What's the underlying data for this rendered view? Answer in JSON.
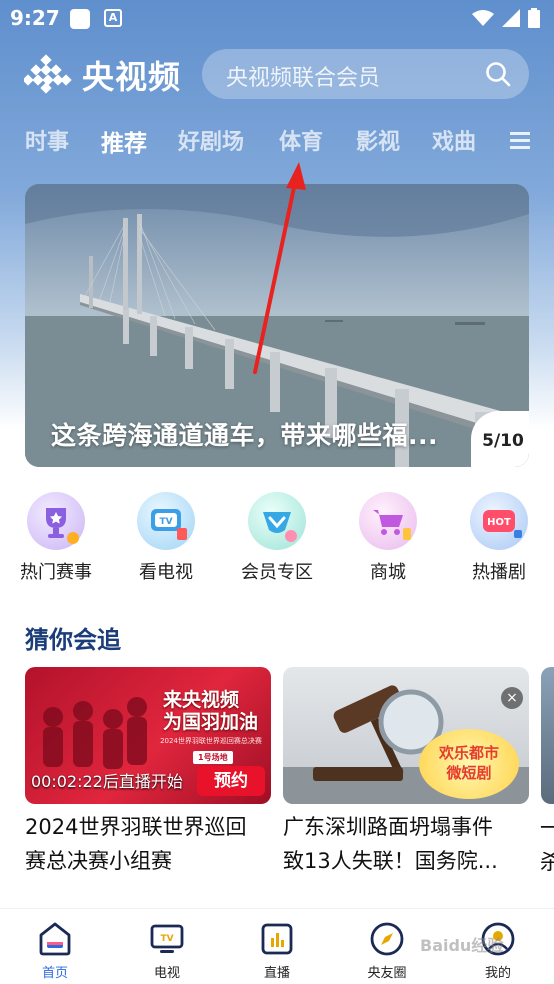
{
  "status_bar": {
    "time": "9:27",
    "a_icon": "A"
  },
  "header": {
    "app_title": "央视频",
    "search_placeholder": "央视频联合会员"
  },
  "tabs": [
    {
      "label": "时事",
      "active": false
    },
    {
      "label": "推荐",
      "active": true
    },
    {
      "label": "好剧场",
      "active": false
    },
    {
      "label": "体育",
      "active": false
    },
    {
      "label": "影视",
      "active": false
    },
    {
      "label": "戏曲",
      "active": false
    }
  ],
  "banner": {
    "title": "这条跨海通道通车，带来哪些福...",
    "page": "5/10"
  },
  "quick_links": [
    {
      "label": "热门赛事",
      "icon": "trophy-icon"
    },
    {
      "label": "看电视",
      "icon": "tv-icon"
    },
    {
      "label": "会员专区",
      "icon": "vip-icon"
    },
    {
      "label": "商城",
      "icon": "cart-icon"
    },
    {
      "label": "热播剧",
      "icon": "hot-icon"
    }
  ],
  "section": {
    "title": "猜你会追",
    "cards": [
      {
        "title_line1": "2024世界羽联世界巡回",
        "title_line2": "赛总决赛小组赛",
        "countdown": "00:02:22后直播开始",
        "action": "预约",
        "poster_text1": "来央视频",
        "poster_text2": "为国羽加油",
        "poster_sub": "2024世界羽联世界巡回赛总决赛",
        "poster_tag": "1号场地"
      },
      {
        "title_line1": "广东深圳路面坍塌事件",
        "title_line2": "致13人失联！国务院...",
        "badge_line1": "欢乐都市",
        "badge_line2": "微短剧",
        "close": "×"
      },
      {
        "title_line1": "一",
        "title_line2": "杀"
      }
    ]
  },
  "bottom_nav": [
    {
      "label": "首页",
      "active": true
    },
    {
      "label": "电视",
      "active": false
    },
    {
      "label": "直播",
      "active": false
    },
    {
      "label": "央友圈",
      "active": false
    },
    {
      "label": "我的",
      "active": false
    }
  ],
  "watermark": "Baidu经验",
  "colors": {
    "accent": "#2b6be0",
    "reserve": "#e8132a",
    "section_title": "#1b3e7a"
  }
}
